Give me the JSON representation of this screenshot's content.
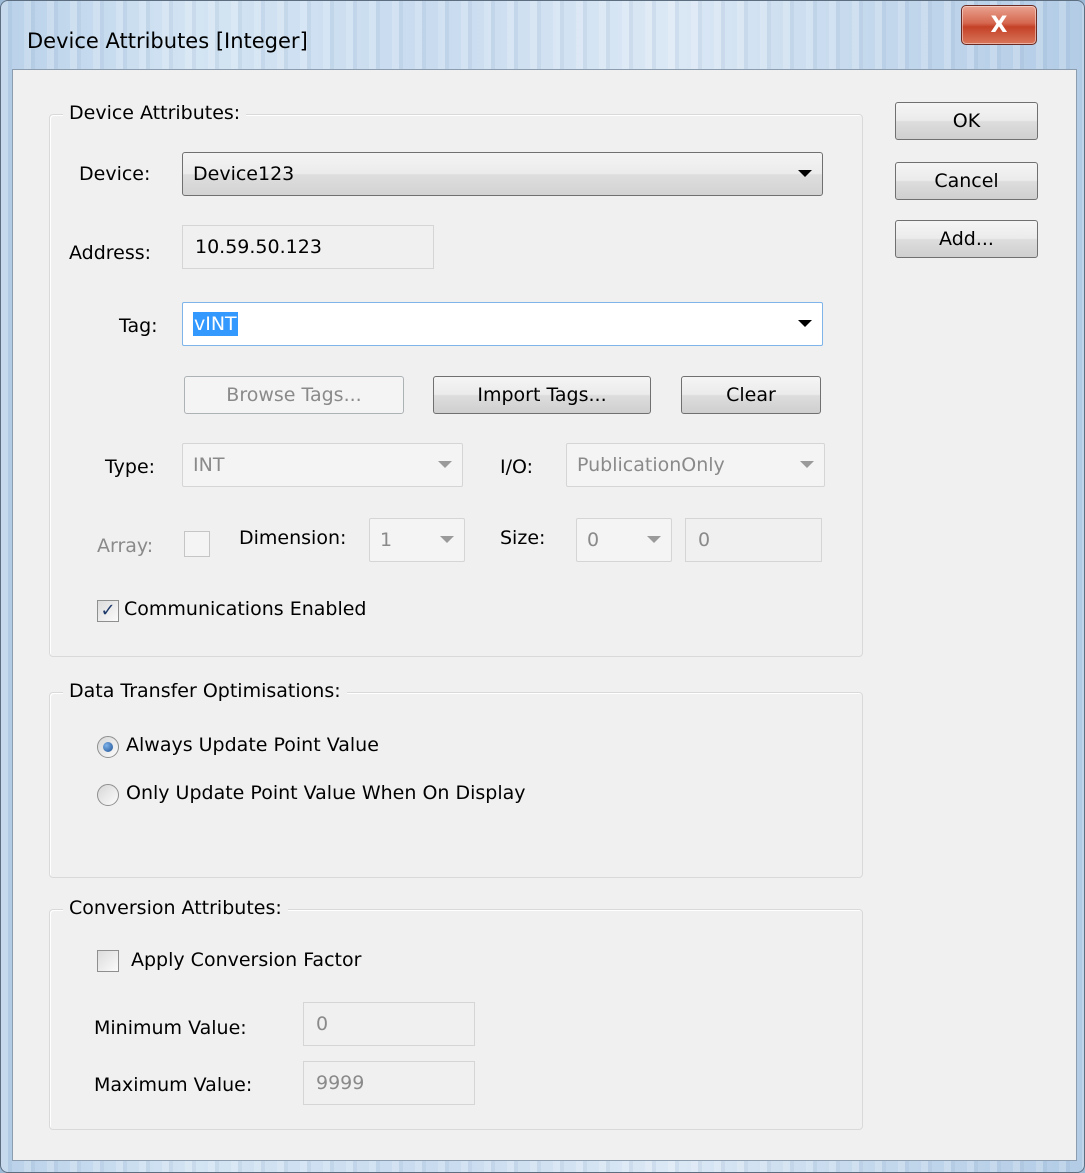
{
  "window": {
    "title": "Device Attributes  [Integer]",
    "close_glyph": "X"
  },
  "buttons": {
    "ok": "OK",
    "cancel": "Cancel",
    "add": "Add..."
  },
  "device_group": {
    "label": "Device Attributes:",
    "device_label": "Device:",
    "device_value": "Device123",
    "address_label": "Address:",
    "address_value": "10.59.50.123",
    "tag_label": "Tag:",
    "tag_value": "vINT",
    "browse_tags": "Browse Tags...",
    "import_tags": "Import Tags...",
    "clear": "Clear",
    "type_label": "Type:",
    "type_value": "INT",
    "io_label": "I/O:",
    "io_value": "PublicationOnly",
    "array_label": "Array:",
    "array_checked": false,
    "dimension_label": "Dimension:",
    "dimension_value": "1",
    "size_label": "Size:",
    "size_value": "0",
    "size_field_value": "0",
    "comms_label": "Communications Enabled",
    "comms_checked": true
  },
  "transfer_group": {
    "label": "Data Transfer Optimisations:",
    "option_always": "Always Update Point Value",
    "option_display": "Only Update Point Value When On Display",
    "selected": "always"
  },
  "conversion_group": {
    "label": "Conversion Attributes:",
    "apply_label": "Apply Conversion Factor",
    "apply_checked": false,
    "min_label": "Minimum Value:",
    "min_value": "0",
    "max_label": "Maximum Value:",
    "max_value": "9999"
  },
  "icons": {
    "check": "✓",
    "dropdown": "chevron-down-icon",
    "close": "close-icon"
  },
  "colors": {
    "selection": "#3399ff",
    "close_button": "#c44126",
    "dialog_face": "#f0f0f0"
  }
}
